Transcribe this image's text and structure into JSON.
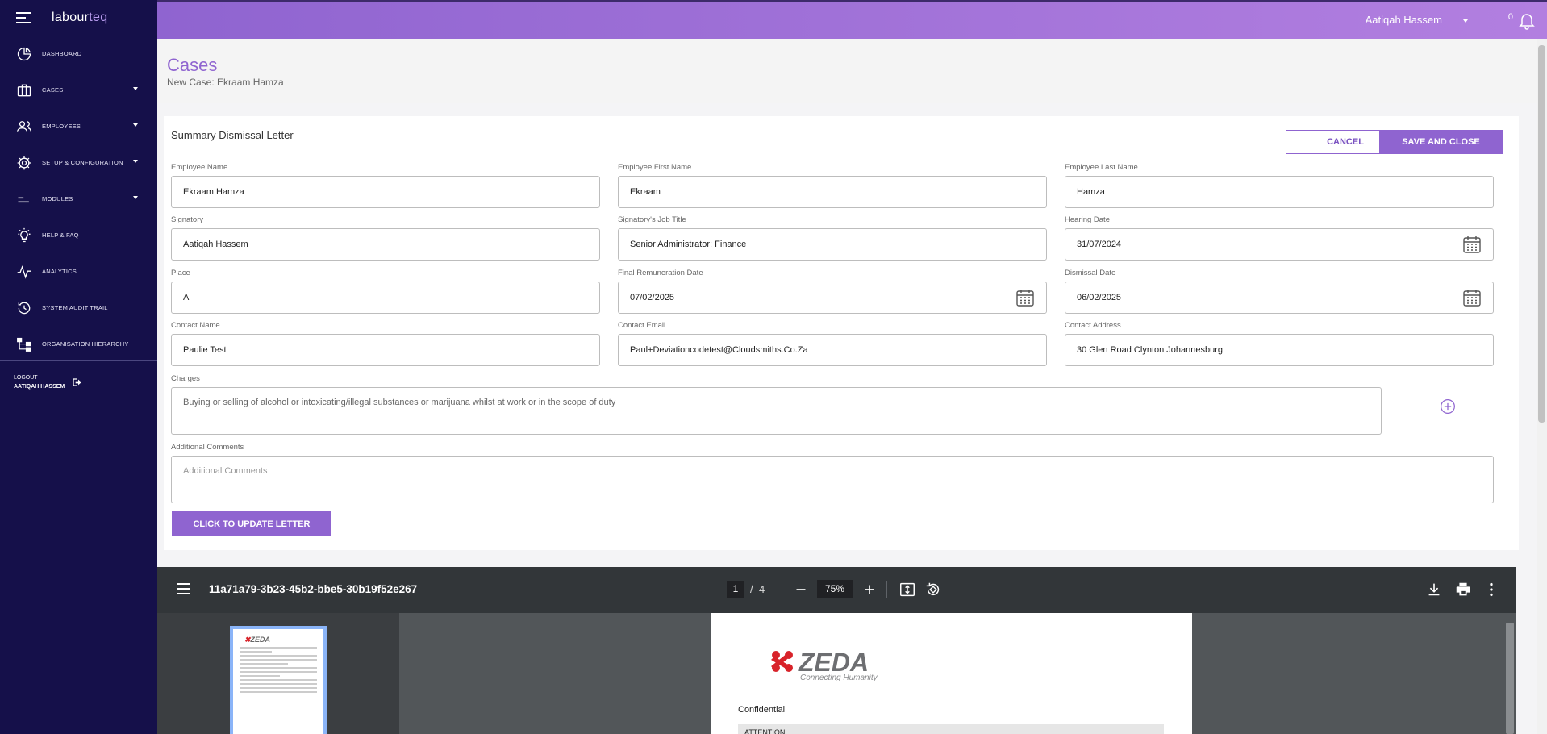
{
  "app": {
    "logo_main": "labour",
    "logo_accent": "teq"
  },
  "sidebar": {
    "items": [
      {
        "label": "Dashboard",
        "icon": "pie-chart-icon"
      },
      {
        "label": "Cases",
        "icon": "briefcase-icon"
      },
      {
        "label": "Employees",
        "icon": "users-icon"
      },
      {
        "label": "Setup & Configuration",
        "icon": "gear-icon"
      },
      {
        "label": "Modules",
        "icon": "sliders-icon"
      },
      {
        "label": "Help & FAQ",
        "icon": "lightbulb-icon"
      },
      {
        "label": "Analytics",
        "icon": "activity-icon"
      },
      {
        "label": "System Audit Trail",
        "icon": "history-icon"
      },
      {
        "label": "Organisation Hierarchy",
        "icon": "hierarchy-icon"
      }
    ],
    "logout_label": "Logout",
    "logout_user": "Aatiqah Hassem"
  },
  "topbar": {
    "user_name": "Aatiqah Hassem",
    "notification_count": "0"
  },
  "header": {
    "title": "Cases",
    "subtitle": "New Case: Ekraam Hamza"
  },
  "form": {
    "title": "Summary Dismissal Letter",
    "cancel_label": "CANCEL",
    "save_label": "SAVE AND CLOSE",
    "employee_name": {
      "label": "Employee Name",
      "value": "Ekraam Hamza"
    },
    "employee_first_name": {
      "label": "Employee First Name",
      "value": "Ekraam"
    },
    "employee_last_name": {
      "label": "Employee Last Name",
      "value": "Hamza"
    },
    "signatory": {
      "label": "Signatory",
      "value": "Aatiqah Hassem"
    },
    "signatory_job_title": {
      "label": "Signatory's Job Title",
      "value": "Senior Administrator: Finance"
    },
    "hearing_date": {
      "label": "Hearing Date",
      "value": "31/07/2024"
    },
    "place": {
      "label": "Place",
      "value": "A"
    },
    "final_remuneration_date": {
      "label": "Final Remuneration Date",
      "value": "07/02/2025"
    },
    "dismissal_date": {
      "label": "Dismissal Date",
      "value": "06/02/2025"
    },
    "contact_name": {
      "label": "Contact Name",
      "value": "Paulie Test"
    },
    "contact_email": {
      "label": "Contact Email",
      "value": "Paul+Deviationcodetest@Cloudsmiths.Co.Za"
    },
    "contact_address": {
      "label": "Contact Address",
      "value": "30 Glen Road Clynton Johannesburg"
    },
    "charges": {
      "label": "Charges",
      "value": "Buying or selling of alcohol or intoxicating/illegal substances or marijuana whilst at work or in the scope of duty"
    },
    "additional_comments": {
      "label": "Additional Comments",
      "placeholder": "Additional Comments"
    },
    "update_label": "CLICK TO UPDATE LETTER"
  },
  "pdf": {
    "filename": "11a71a79-3b23-45b2-bbe5-30b19f52e267",
    "current_page": "1",
    "separator": "/",
    "total_pages": "4",
    "zoom": "75%",
    "logo_text": "ZEDA",
    "logo_tagline": "Connecting Humanity",
    "confidential": "Confidential",
    "attention": "ATTENTION",
    "thumb_logo": "ZEDA"
  },
  "colors": {
    "sidebar_bg": "#15104a",
    "accent": "#8f64d0",
    "topbar_gradient_end": "#b27fe0",
    "pdf_toolbar": "#323639",
    "zeda_red": "#d8232a"
  }
}
